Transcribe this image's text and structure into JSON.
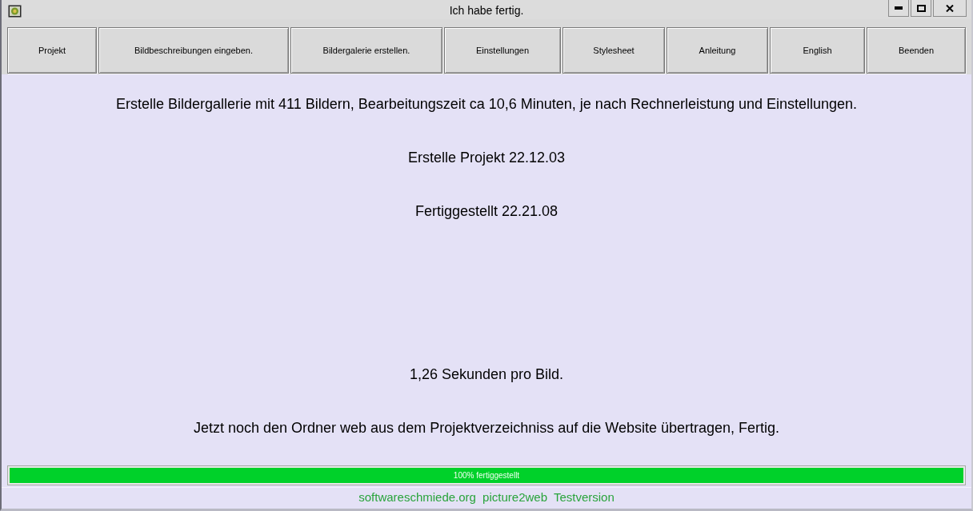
{
  "window": {
    "title": "Ich habe fertig."
  },
  "toolbar": [
    {
      "label": "Projekt"
    },
    {
      "label": "Bildbeschreibungen eingeben."
    },
    {
      "label": "Bildergalerie erstellen."
    },
    {
      "label": "Einstellungen"
    },
    {
      "label": "Stylesheet"
    },
    {
      "label": "Anleitung"
    },
    {
      "label": "English"
    },
    {
      "label": "Beenden"
    }
  ],
  "messages": [
    "Erstelle Bildergallerie mit 411 Bildern, Bearbeitungszeit ca 10,6 Minuten, je nach Rechnerleistung und Einstellungen.",
    "Erstelle Projekt 22.12.03",
    "Fertiggestellt 22.21.08",
    "1,26 Sekunden pro Bild.",
    "Jetzt noch den Ordner web aus dem Projektverzeichniss auf die Website übertragen, Fertig."
  ],
  "progress": {
    "level": 1,
    "label": "100% fertiggestellt"
  },
  "status_bar": {
    "text": "softwareschmiede.org picture2web Testversion"
  }
}
